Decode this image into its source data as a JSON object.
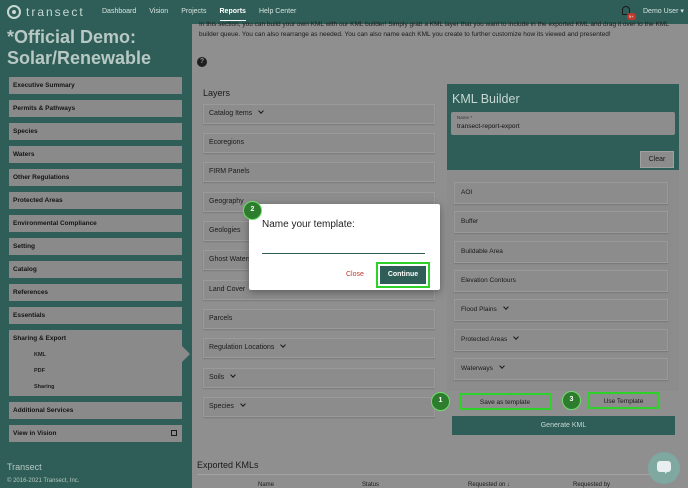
{
  "nav": {
    "logo_text": "transect",
    "items": [
      "Dashboard",
      "Vision",
      "Projects",
      "Reports",
      "Help Center"
    ],
    "active": "Reports",
    "notification_count": "9+",
    "user_label": "Demo User ▾"
  },
  "sidebar": {
    "title": "*Official Demo: Solar/Renewable",
    "items": [
      "Executive Summary",
      "Permits & Pathways",
      "Species",
      "Waters",
      "Other Regulations",
      "Protected Areas",
      "Environmental Compliance",
      "Setting",
      "Catalog",
      "References",
      "Essentials"
    ],
    "active_group": {
      "label": "Sharing & Export",
      "subitems": [
        "KML",
        "PDF",
        "Sharing"
      ]
    },
    "after_items": [
      "Additional Services",
      "View in Vision"
    ],
    "footer_title": "Transect",
    "footer_copy": "© 2016-2021 Transect, Inc."
  },
  "main": {
    "intro": "In this section, you can build your own KML with our KML builder! Simply grab a KML layer that you want to include in the exported KML and drag it over to the KML builder queue. You can also rearrange as needed. You can also name each KML you create to further customize how its viewed and presented!",
    "help_icon": "question-circle-icon",
    "layers_title": "Layers",
    "layers": [
      {
        "label": "Catalog Items",
        "has_chevron": true
      },
      {
        "label": "Ecoregions",
        "has_chevron": false
      },
      {
        "label": "FIRM Panels",
        "has_chevron": false
      },
      {
        "label": "Geography",
        "has_chevron": false
      },
      {
        "label": "Geologies",
        "has_chevron": false
      },
      {
        "label": "Ghost Waters",
        "has_chevron": false
      },
      {
        "label": "Land Cover",
        "has_chevron": true
      },
      {
        "label": "Parcels",
        "has_chevron": false
      },
      {
        "label": "Regulation Locations",
        "has_chevron": true
      },
      {
        "label": "Soils",
        "has_chevron": true
      },
      {
        "label": "Species",
        "has_chevron": true
      }
    ],
    "builder": {
      "title": "KML Builder",
      "name_label": "Name *",
      "name_value": "transect-report-export",
      "clear_label": "Clear",
      "items": [
        {
          "label": "AOI",
          "has_chevron": false
        },
        {
          "label": "Buffer",
          "has_chevron": false
        },
        {
          "label": "Buildable Area",
          "has_chevron": false
        },
        {
          "label": "Elevation Contours",
          "has_chevron": false
        },
        {
          "label": "Flood Plains",
          "has_chevron": true
        },
        {
          "label": "Protected Areas",
          "has_chevron": true
        },
        {
          "label": "Waterways",
          "has_chevron": true
        }
      ],
      "save_template_label": "Save as template",
      "use_template_label": "Use Template",
      "generate_label": "Generate KML"
    },
    "exported_title": "Exported KMLs",
    "exported_columns": [
      "Name",
      "Status",
      "Requested on ↓",
      "Requested by"
    ]
  },
  "modal": {
    "title": "Name your template:",
    "input_value": "",
    "close_label": "Close",
    "continue_label": "Continue"
  },
  "badges": [
    "1",
    "2",
    "3"
  ],
  "colors": {
    "brand": "#2e5e57",
    "highlight": "#2ed12a",
    "badge": "#2e7d2e",
    "close": "#c0392b"
  }
}
